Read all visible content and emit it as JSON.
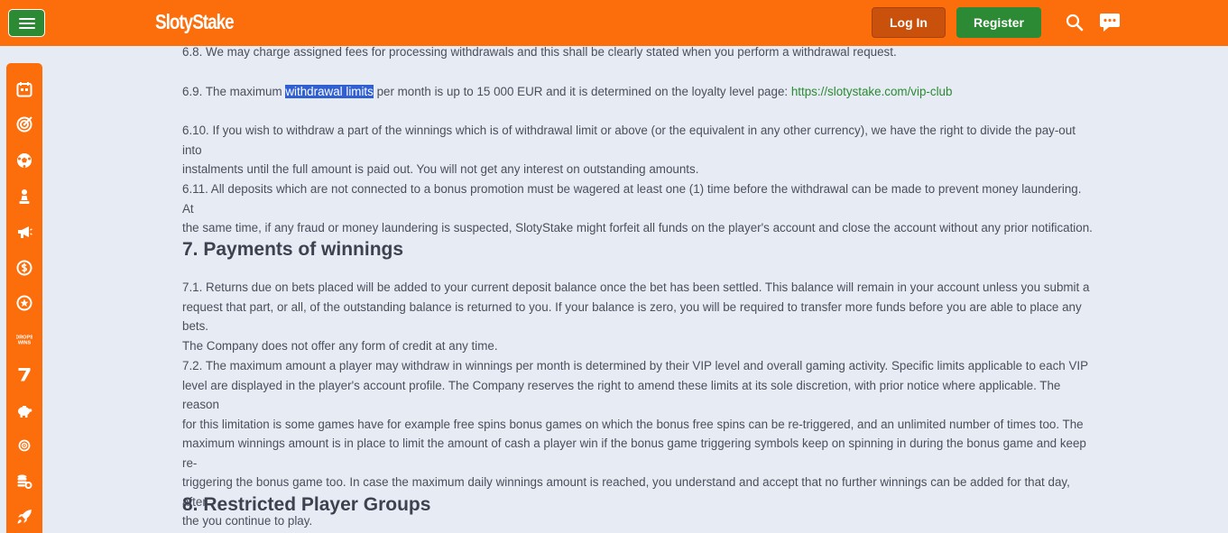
{
  "header": {
    "logo": "SlotyStake",
    "login_label": "Log In",
    "register_label": "Register",
    "icons": [
      "hamburger-menu-icon",
      "search-icon",
      "chat-icon"
    ]
  },
  "sidebar": {
    "icons": [
      "calendar-icon",
      "target-icon",
      "soccer-ball-icon",
      "chess-pawn-icon",
      "megaphone-icon",
      "coin-icon",
      "star-badge-icon",
      "drops-wins-icon",
      "seven-icon",
      "piggy-bank-icon",
      "bullseye-icon",
      "coins-stack-icon",
      "rocket-icon"
    ]
  },
  "terms": {
    "p6_8": "6.8. We may charge assigned fees for processing withdrawals and this shall be clearly stated when you perform a withdrawal request.",
    "p6_9_prefix": "6.9. The maximum ",
    "p6_9_highlight": "withdrawal limits",
    "p6_9_suffix": " per month is up to 15 000 EUR and it is determined on the loyalty level page: ",
    "p6_9_link": "https://slotystake.com/vip-club",
    "p6_10_line1": "6.10. If you wish to withdraw a part of the winnings which is of withdrawal limit or above (or the equivalent in any other currency), we have the right to divide the pay-out into",
    "p6_10_line2": "instalments until the full amount is paid out. You will not get any interest on outstanding amounts.",
    "p6_11_line1": "6.11. All deposits which are not connected to a bonus promotion must be wagered at least one (1) time before the withdrawal can be made to prevent money laundering. At",
    "p6_11_line2": "the same time, if any fraud or money laundering is suspected, SlotyStake might forfeit all funds on the player's account and close the account without any prior notification.",
    "h7": "7. Payments of winnings",
    "p7_1_line1": "7.1. Returns due on bets placed will be added to your current deposit balance once the bet has been settled. This balance will remain in your account unless you submit a",
    "p7_1_line2": "request that part, or all, of the outstanding balance is returned to you. If your balance is zero, you will be required to transfer more funds before you are able to place any bets.",
    "p7_1_line3": "The Company does not offer any form of credit at any time.",
    "p7_2_line1": "7.2. The maximum amount a player may withdraw in winnings per month is determined by their VIP level and overall gaming activity. Specific limits applicable to each VIP",
    "p7_2_line2": "level are displayed in the player's account profile. The Company reserves the right to amend these limits at its sole discretion, with prior notice where applicable. The reason",
    "p7_2_line3": "for this limitation is some games have for example free spins bonus games on which the bonus free spins can be re-triggered, and an unlimited number of times too. The",
    "p7_2_line4": "maximum winnings amount is in place to limit the amount of cash a player win if the bonus game triggering symbols keep on spinning in during the bonus game and keep re-",
    "p7_2_line5": "triggering the bonus game too. In case the maximum daily winnings amount is reached, you understand and accept that no further winnings can be added for that day, after",
    "p7_2_line6": "the you continue to play.",
    "h8": "8. Restricted Player Groups"
  }
}
